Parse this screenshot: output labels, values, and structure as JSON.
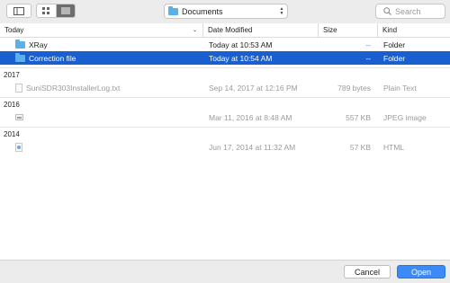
{
  "toolbar": {
    "path_label": "Documents",
    "search_placeholder": "Search"
  },
  "columns": {
    "name": "Today",
    "date": "Date Modified",
    "size": "Size",
    "kind": "Kind"
  },
  "groups": {
    "today": {
      "rows": [
        {
          "name": "XRay",
          "date": "Today at 10:53 AM",
          "size": "--",
          "kind": "Folder"
        },
        {
          "name": "Correction file",
          "date": "Today at 10:54 AM",
          "size": "--",
          "kind": "Folder"
        }
      ]
    },
    "y2017": {
      "label": "2017",
      "rows": [
        {
          "name": "SuniSDR303InstallerLog.txt",
          "date": "Sep 14, 2017 at 12:16 PM",
          "size": "789 bytes",
          "kind": "Plain Text"
        }
      ]
    },
    "y2016": {
      "label": "2016",
      "rows": [
        {
          "name": "",
          "date": "Mar 11, 2016 at 8:48 AM",
          "size": "557 KB",
          "kind": "JPEG image"
        }
      ]
    },
    "y2014": {
      "label": "2014",
      "rows": [
        {
          "name": "",
          "date": "Jun 17, 2014 at 11:32 AM",
          "size": "57 KB",
          "kind": "HTML"
        }
      ]
    }
  },
  "footer": {
    "cancel_label": "Cancel",
    "open_label": "Open"
  },
  "colors": {
    "selection": "#1a5fd0",
    "primary_button": "#3b8af7",
    "folder": "#5ab0ea"
  },
  "icons": [
    "sidebar-toggle-icon",
    "icon-view-icon",
    "list-view-icon",
    "folder-icon",
    "updown-chevron-icon",
    "search-icon",
    "document-icon",
    "image-file-icon",
    "html-file-icon"
  ]
}
